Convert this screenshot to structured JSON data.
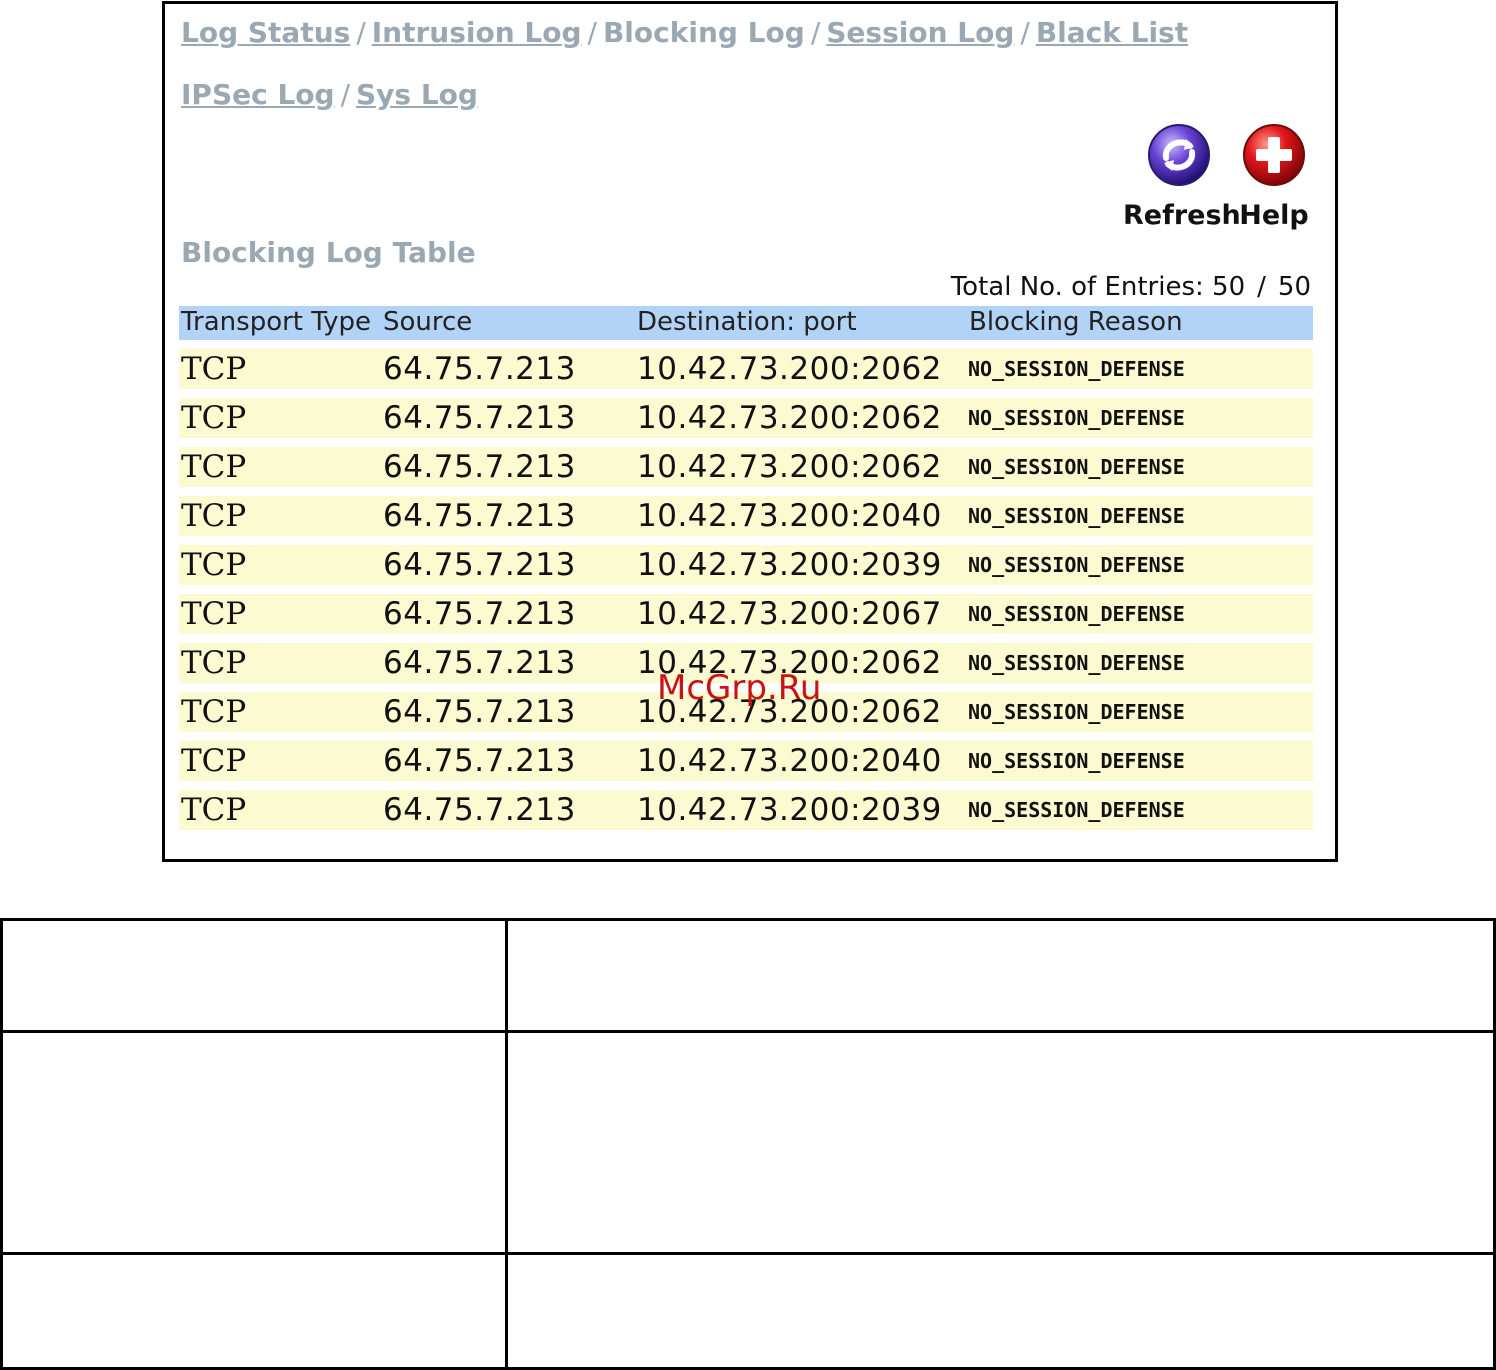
{
  "nav": {
    "log_status": "Log Status",
    "intrusion_log": "Intrusion Log",
    "blocking_log": "Blocking Log",
    "session_log": "Session Log",
    "black_list": "Black List",
    "ipsec_log": "IPSec Log",
    "sys_log": "Sys Log",
    "separator": "/"
  },
  "toolbar": {
    "refresh_label": "Refresh",
    "help_label": "Help",
    "refresh_icon": "refresh-icon",
    "help_icon": "help-icon",
    "refresh_color": "#5b35c8",
    "help_color": "#e3161b"
  },
  "table": {
    "title": "Blocking Log Table",
    "total_label": "Total No. of Entries:",
    "total_shown": "50",
    "total_separator": "/",
    "total_all": "50",
    "columns": [
      "Transport Type",
      "Source",
      "Destination: port",
      "Blocking Reason"
    ],
    "rows": [
      {
        "type": "TCP",
        "source": "64.75.7.213",
        "destination": "10.42.73.200:2062",
        "reason": "NO_SESSION_DEFENSE"
      },
      {
        "type": "TCP",
        "source": "64.75.7.213",
        "destination": "10.42.73.200:2062",
        "reason": "NO_SESSION_DEFENSE"
      },
      {
        "type": "TCP",
        "source": "64.75.7.213",
        "destination": "10.42.73.200:2062",
        "reason": "NO_SESSION_DEFENSE"
      },
      {
        "type": "TCP",
        "source": "64.75.7.213",
        "destination": "10.42.73.200:2040",
        "reason": "NO_SESSION_DEFENSE"
      },
      {
        "type": "TCP",
        "source": "64.75.7.213",
        "destination": "10.42.73.200:2039",
        "reason": "NO_SESSION_DEFENSE"
      },
      {
        "type": "TCP",
        "source": "64.75.7.213",
        "destination": "10.42.73.200:2067",
        "reason": "NO_SESSION_DEFENSE"
      },
      {
        "type": "TCP",
        "source": "64.75.7.213",
        "destination": "10.42.73.200:2062",
        "reason": "NO_SESSION_DEFENSE"
      },
      {
        "type": "TCP",
        "source": "64.75.7.213",
        "destination": "10.42.73.200:2062",
        "reason": "NO_SESSION_DEFENSE"
      },
      {
        "type": "TCP",
        "source": "64.75.7.213",
        "destination": "10.42.73.200:2040",
        "reason": "NO_SESSION_DEFENSE"
      },
      {
        "type": "TCP",
        "source": "64.75.7.213",
        "destination": "10.42.73.200:2039",
        "reason": "NO_SESSION_DEFENSE"
      }
    ],
    "header_color": "#b3d3f6",
    "row_color": "#fbfad0"
  },
  "watermark": "McGrp.Ru"
}
